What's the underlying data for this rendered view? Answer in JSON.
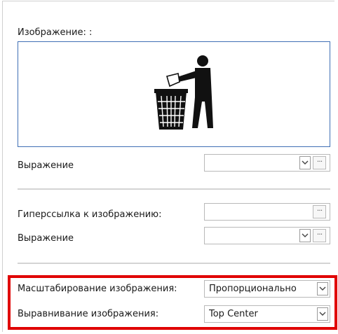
{
  "image": {
    "label": "Изображение: :",
    "icon": "trash-bin-recycle-icon"
  },
  "expression1": {
    "label": "Выражение",
    "value": ""
  },
  "hyperlink": {
    "label": "Гиперссылка к изображению:",
    "value": ""
  },
  "expression2": {
    "label": "Выражение",
    "value": ""
  },
  "scaling": {
    "label": "Масштабирование изображения:",
    "value": "Пропорционально"
  },
  "alignment": {
    "label": "Выравнивание изображения:",
    "value": "Top Center"
  },
  "buttons": {
    "ellipsis": "···"
  },
  "colors": {
    "highlight": "#e00000",
    "image_border": "#3f6fb5"
  }
}
